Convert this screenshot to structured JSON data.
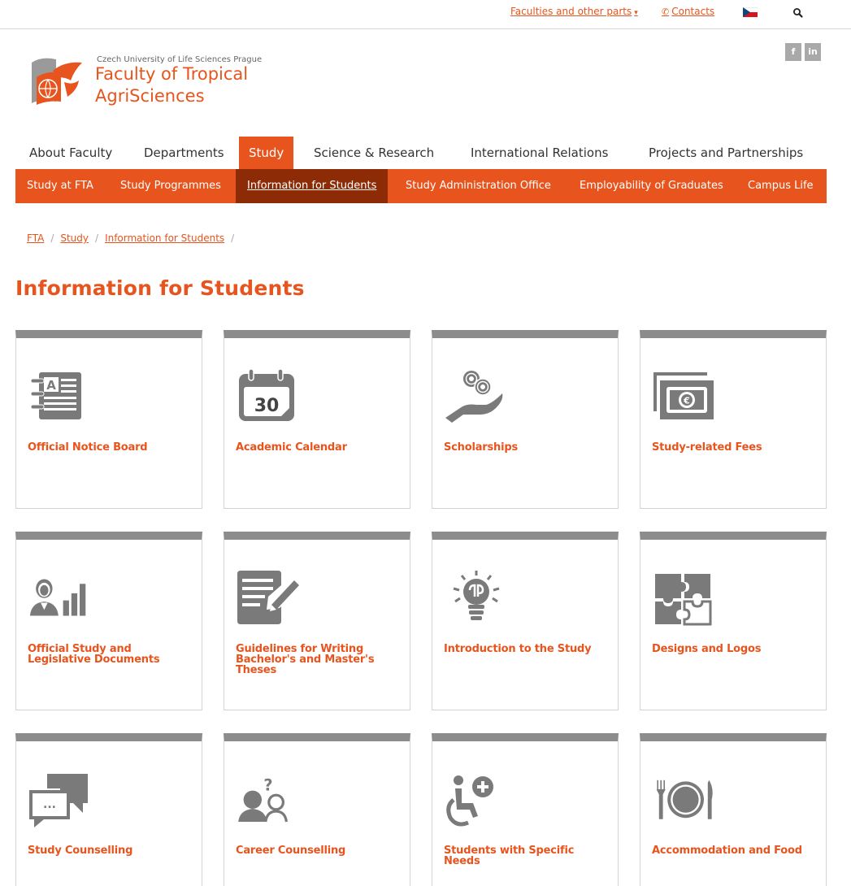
{
  "topbar": {
    "faculties_label": "Faculties and other parts",
    "contacts_label": "Contacts",
    "language": "Czech",
    "icons": [
      "chevron-down-icon",
      "phone-icon",
      "czech-flag-icon",
      "search-icon"
    ]
  },
  "header": {
    "university": "Czech University of Life Sciences Prague",
    "faculty_line1": "Faculty of Tropical",
    "faculty_line2": "AgriSciences",
    "social": [
      "f",
      "in"
    ]
  },
  "main_nav": {
    "items": [
      {
        "label": "About Faculty"
      },
      {
        "label": "Departments"
      },
      {
        "label": "Study"
      },
      {
        "label": "Science & Research"
      },
      {
        "label": "International Relations"
      },
      {
        "label": "Projects and Partnerships"
      }
    ],
    "active": "Study"
  },
  "sub_nav": {
    "items": [
      {
        "label": "Study at FTA"
      },
      {
        "label": "Study Programmes"
      },
      {
        "label": "Information for Students"
      },
      {
        "label": "Study Administration Office"
      },
      {
        "label": "Employability of Graduates"
      },
      {
        "label": "Campus Life"
      }
    ],
    "active": "Information for Students"
  },
  "breadcrumb": {
    "items": [
      {
        "label": "FTA"
      },
      {
        "label": "Study"
      },
      {
        "label": "Information for Students"
      }
    ],
    "separator": "/"
  },
  "page": {
    "title": "Information for Students"
  },
  "cards": [
    {
      "label": "Official Notice Board",
      "icon": "notice-board-icon"
    },
    {
      "label": "Academic Calendar",
      "icon": "calendar-icon",
      "calendar_day": "30"
    },
    {
      "label": "Scholarships",
      "icon": "coins-hand-icon"
    },
    {
      "label": "Study-related Fees",
      "icon": "banknote-icon"
    },
    {
      "label": "Official Study and Legislative Documents",
      "icon": "person-chart-icon"
    },
    {
      "label": "Guidelines for Writing Bachelor's and Master's Theses",
      "icon": "document-pencil-icon"
    },
    {
      "label": "Introduction to the Study",
      "icon": "lightbulb-icon"
    },
    {
      "label": "Designs and Logos",
      "icon": "puzzle-icon"
    },
    {
      "label": "Study Counselling",
      "icon": "chat-bubbles-icon",
      "bubble_text": "..."
    },
    {
      "label": "Career Counselling",
      "icon": "people-question-icon",
      "question_mark": "?"
    },
    {
      "label": "Students with Specific Needs",
      "icon": "wheelchair-icon"
    },
    {
      "label": "Accommodation and Food",
      "icon": "plate-cutlery-icon"
    }
  ],
  "colors": {
    "accent": "#e8541d",
    "accent_dark": "#8d2b06",
    "icon_gray": "#7a7a7a",
    "card_border_top": "#8c8c8c"
  }
}
